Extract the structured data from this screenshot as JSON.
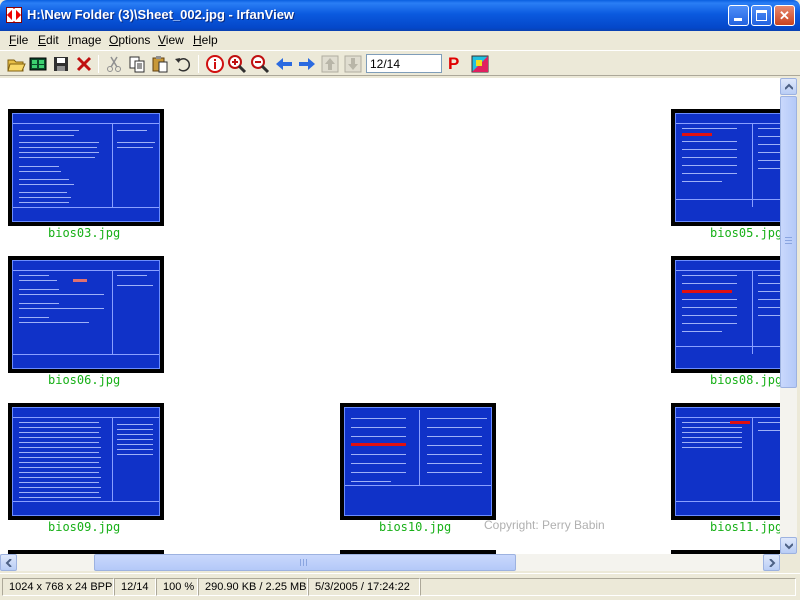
{
  "window": {
    "title": "H:\\New Folder (3)\\Sheet_002.jpg - IrfanView",
    "minimize_label": "",
    "maximize_label": "",
    "close_label": "✕"
  },
  "menu": [
    {
      "first": "F",
      "rest": "ile"
    },
    {
      "first": "E",
      "rest": "dit"
    },
    {
      "first": "I",
      "rest": "mage"
    },
    {
      "first": "O",
      "rest": "ptions"
    },
    {
      "first": "V",
      "rest": "iew"
    },
    {
      "first": "H",
      "rest": "elp"
    }
  ],
  "toolbar": {
    "icons": [
      "open-icon",
      "thumbnails-icon",
      "save-icon",
      "delete-icon",
      "cut-icon",
      "copy-icon",
      "paste-icon",
      "undo-icon",
      "info-icon",
      "zoom-in-icon",
      "zoom-out-icon",
      "previous-icon",
      "next-icon",
      "up-icon",
      "down-icon"
    ],
    "page_value": "12/14",
    "p_label": "P"
  },
  "thumbnails": [
    {
      "label": "bios03.jpg"
    },
    {
      "label": "bios05.jpg"
    },
    {
      "label": "bios06.jpg"
    },
    {
      "label": "bios08.jpg"
    },
    {
      "label": "bios09.jpg"
    },
    {
      "label": "bios10.jpg"
    },
    {
      "label": "bios11.jpg"
    }
  ],
  "copyright": "Copyright: Perry Babin",
  "statusbar": {
    "dimensions": "1024 x 768 x 24 BPP",
    "page": "12/14",
    "zoom": "100 %",
    "size": "290.90 KB / 2.25 MB",
    "datetime": "5/3/2005 / 17:24:22"
  },
  "colors": {
    "titlebar": "#0b5adf",
    "bios_blue": "#1032c8",
    "label_green": "#18b018",
    "highlight_red": "#e01010"
  }
}
